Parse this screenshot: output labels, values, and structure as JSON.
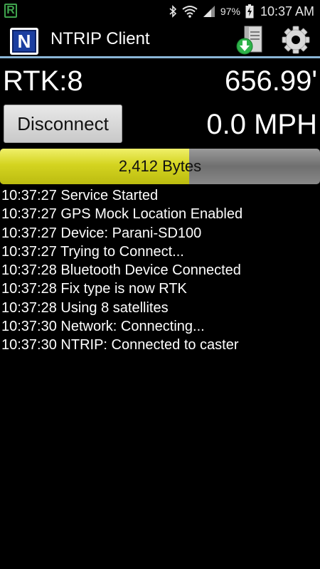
{
  "status_bar": {
    "notification_icon": "R",
    "battery_percent": "97%",
    "time": "10:37 AM",
    "icons": [
      "bluetooth-icon",
      "wifi-icon",
      "signal-icon",
      "battery-charging-icon"
    ]
  },
  "action_bar": {
    "logo_letter": "N",
    "title": "NTRIP Client",
    "actions": [
      "download-server-icon",
      "gear-icon"
    ]
  },
  "main": {
    "rtk": "RTK:8",
    "altitude": "656.99'",
    "disconnect_label": "Disconnect",
    "speed": "0.0 MPH"
  },
  "progress": {
    "label": "2,412 Bytes",
    "fraction": 0.59
  },
  "log": [
    "10:37:27 Service Started",
    "10:37:27 GPS Mock Location Enabled",
    "10:37:27 Device: Parani-SD100",
    "10:37:27 Trying to Connect...",
    "10:37:28 Bluetooth Device Connected",
    "10:37:28 Fix type is now RTK",
    "10:37:28 Using 8 satellites",
    "10:37:30 Network: Connecting...",
    "10:37:30 NTRIP: Connected to caster"
  ],
  "colors": {
    "accent_line": "#8ab6d6",
    "progress_fill": "#d4d420",
    "logo_blue": "#1b3ea0"
  }
}
